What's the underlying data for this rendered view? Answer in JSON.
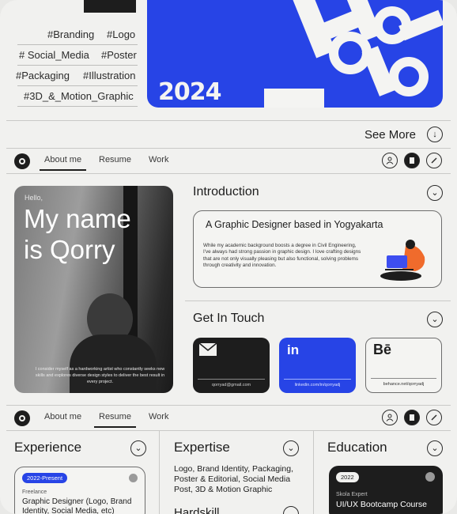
{
  "top": {
    "tags": [
      {
        "id": "branding",
        "label": "#Branding"
      },
      {
        "id": "logo",
        "label": "#Logo"
      },
      {
        "id": "social",
        "label": "# Social_Media"
      },
      {
        "id": "poster",
        "label": "#Poster"
      },
      {
        "id": "packaging",
        "label": "#Packaging"
      },
      {
        "id": "illustration",
        "label": "#Illustration"
      },
      {
        "id": "motion",
        "label": "#3D_&_Motion_Graphic"
      }
    ],
    "banner_year": "2024",
    "see_more": "See More"
  },
  "nav": {
    "tabs": [
      "About me",
      "Resume",
      "Work"
    ]
  },
  "profile": {
    "greeting": "Hello,",
    "name_line1": "My name",
    "name_line2": "is Qorry",
    "blurb": "I consider myself as a hardworking artist who constantly seeks new skills and explores diverse design styles to deliver the best result in every project."
  },
  "introduction": {
    "title": "Introduction",
    "card_title": "A Graphic Designer based in Yogyakarta",
    "card_body": "While my academic background boosts a degree in Civil Engineering, I've always had strong passion in graphic design. I love crafting designs that are not only visually pleasing but also functional, solving problems through creativity and innovation."
  },
  "contact": {
    "title": "Get In Touch",
    "email": "qorryad@gmail.com",
    "linkedin": "linkedin.com/in/qorryadj",
    "behance": "behance.net/qorryadj",
    "linkedin_glyph": "in",
    "behance_glyph": "Bē"
  },
  "resume": {
    "experience": {
      "title": "Experience",
      "badge": "2022-Present",
      "role_type": "Freelance",
      "role": "Graphic Designer (Logo, Brand Identity, Social Media, etc)"
    },
    "expertise": {
      "title": "Expertise",
      "body": "Logo, Brand Identity, Packaging, Poster & Editorial, Social Media Post, 3D & Motion Graphic",
      "hardskill_title": "Hardskill"
    },
    "education": {
      "title": "Education",
      "badge": "2022",
      "school": "Skola Expert",
      "course": "UI/UX Bootcamp Course"
    }
  },
  "colors": {
    "accent": "#2744e6",
    "dark": "#1d1d1d",
    "background": "#f1f1ef"
  }
}
